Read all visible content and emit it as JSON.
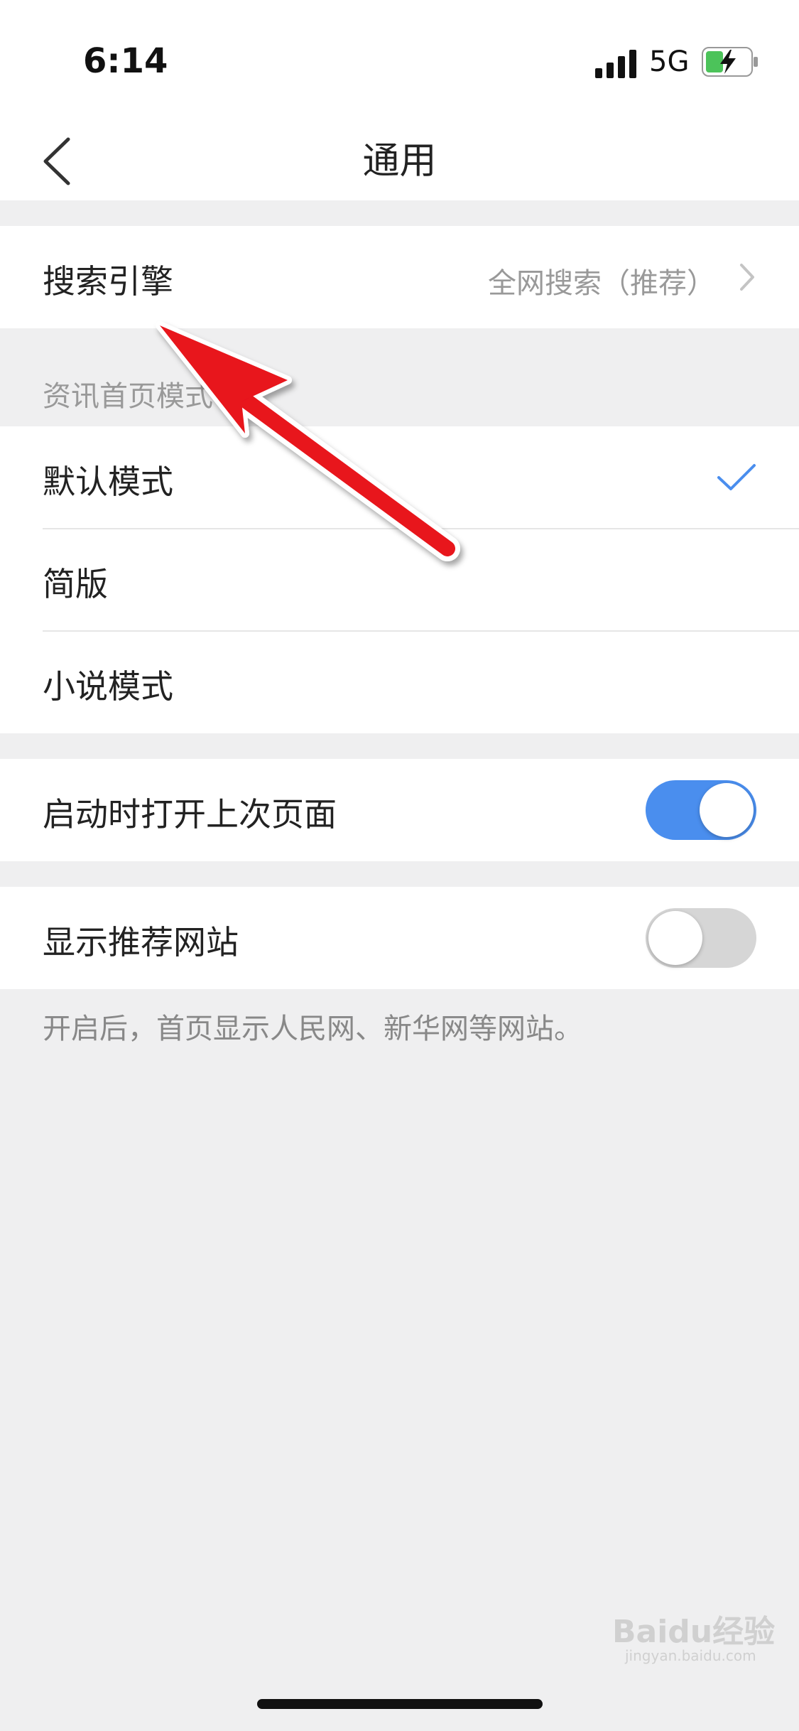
{
  "status_bar": {
    "time": "6:14",
    "network": "5G",
    "icons": [
      "signal-icon",
      "battery-charging-icon"
    ]
  },
  "nav": {
    "title": "通用",
    "back_icon": "chevron-left-icon"
  },
  "search_engine": {
    "label": "搜索引擎",
    "value": "全网搜索（推荐）",
    "icon": "chevron-right-icon"
  },
  "news_home_mode": {
    "header": "资讯首页模式",
    "options": [
      {
        "label": "默认模式",
        "selected": true
      },
      {
        "label": "简版",
        "selected": false
      },
      {
        "label": "小说模式",
        "selected": false
      }
    ],
    "selected_icon": "checkmark-icon",
    "accent_color": "#4a8eee"
  },
  "open_last_page": {
    "label": "启动时打开上次页面",
    "enabled": true
  },
  "show_recommended_sites": {
    "label": "显示推荐网站",
    "enabled": false,
    "footnote": "开启后，首页显示人民网、新华网等网站。"
  },
  "annotation": {
    "icon": "red-arrow-icon",
    "color": "#e8121c"
  },
  "watermark": {
    "text": "Baidu经验",
    "sub": "jingyan.baidu.com"
  }
}
